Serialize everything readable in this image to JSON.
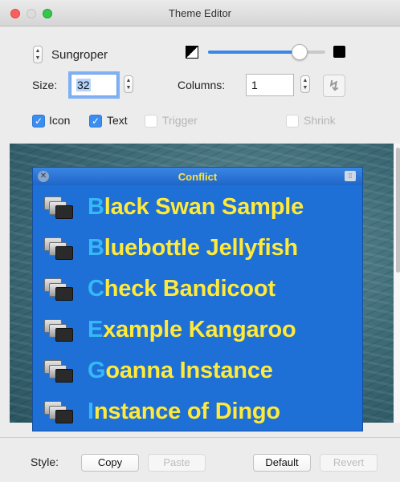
{
  "window": {
    "title": "Theme Editor"
  },
  "controls": {
    "theme_name": "Sungroper",
    "size_label": "Size:",
    "size_value": "32",
    "columns_label": "Columns:",
    "columns_value": "1",
    "color_slider_level": 0.78,
    "checkboxes": [
      {
        "label": "Icon",
        "checked": true,
        "enabled": true
      },
      {
        "label": "Text",
        "checked": true,
        "enabled": true
      },
      {
        "label": "Trigger",
        "checked": false,
        "enabled": false
      },
      {
        "label": "Shrink",
        "checked": false,
        "enabled": false
      }
    ],
    "accent": "#3a87e6"
  },
  "palette": {
    "title": "Conflict",
    "background": "#1e6fd6",
    "text_color": "#ffea3a",
    "initial_color": "#35b8f5",
    "items": [
      {
        "initial": "B",
        "rest": "lack Swan Sample"
      },
      {
        "initial": "B",
        "rest": "luebottle Jellyfish"
      },
      {
        "initial": "C",
        "rest": "heck Bandicoot"
      },
      {
        "initial": "E",
        "rest": "xample Kangaroo"
      },
      {
        "initial": "G",
        "rest": "oanna Instance"
      },
      {
        "initial": "I",
        "rest": "nstance of Dingo"
      }
    ]
  },
  "footer": {
    "style_label": "Style:",
    "copy_label": "Copy",
    "paste_label": "Paste",
    "default_label": "Default",
    "revert_label": "Revert"
  }
}
